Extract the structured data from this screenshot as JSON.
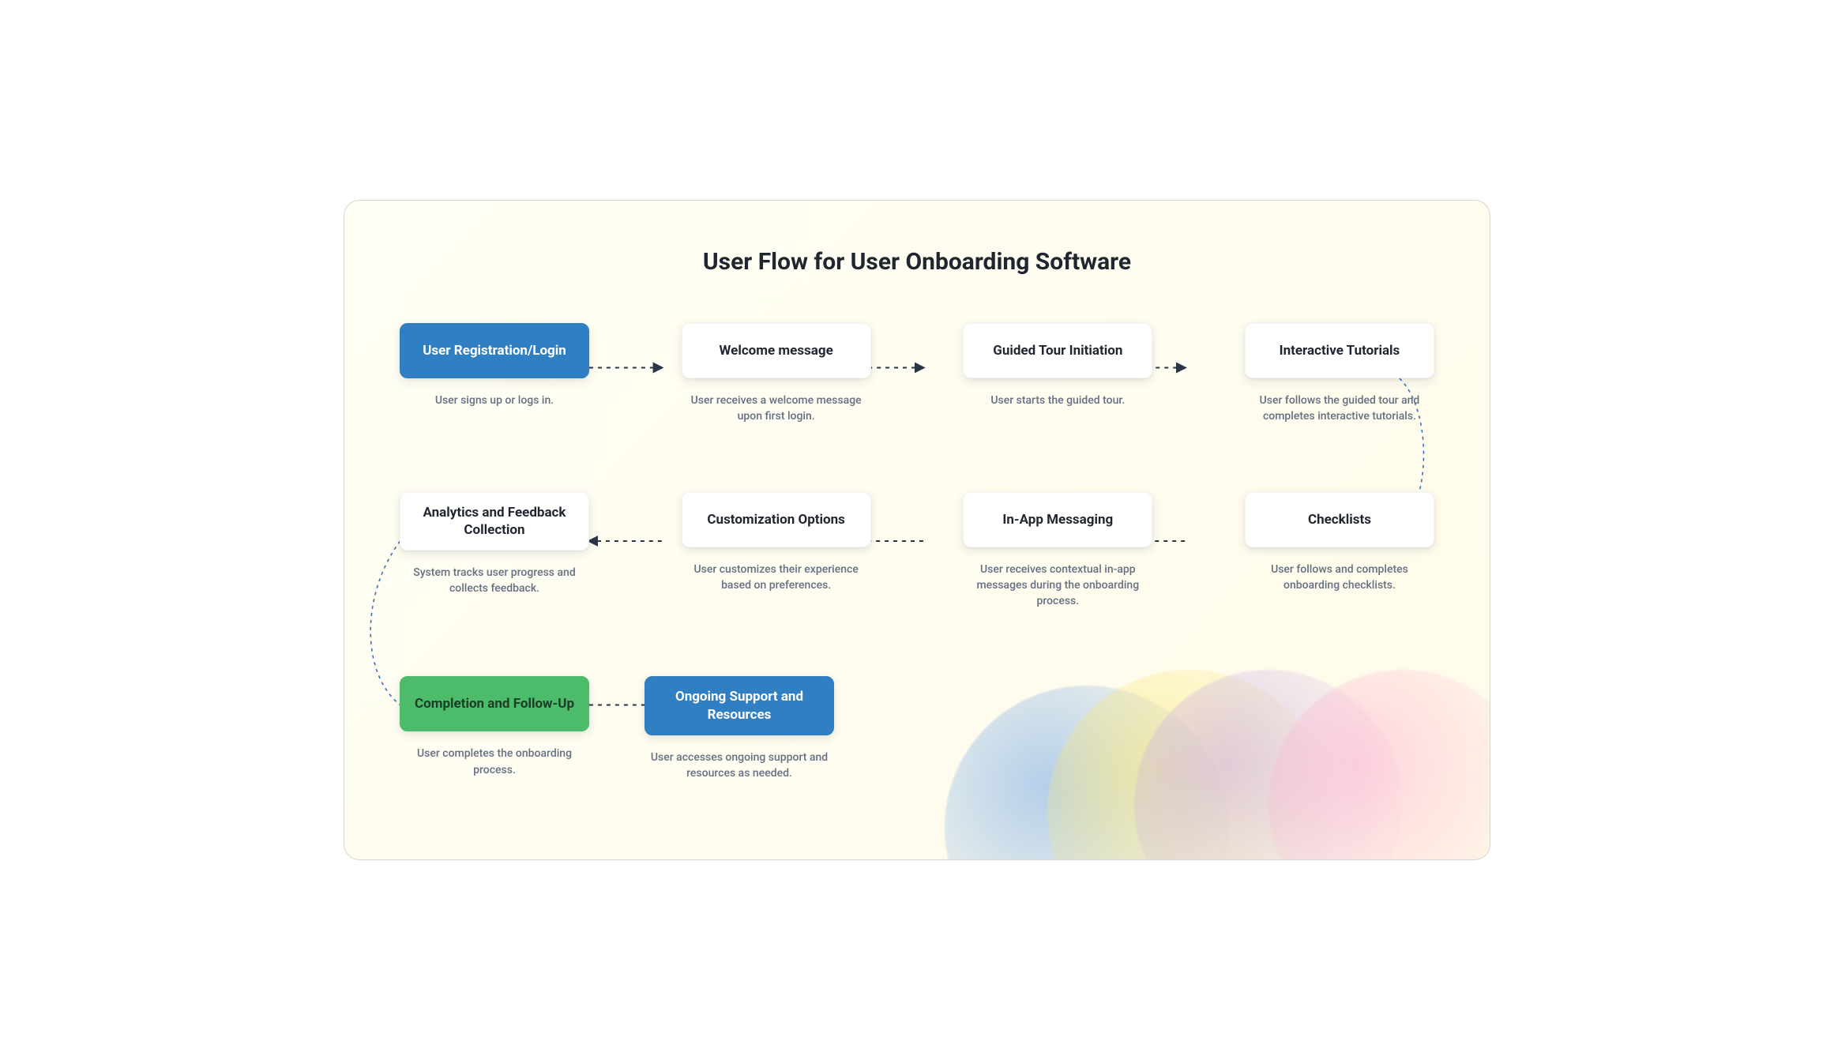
{
  "title": "User Flow for User Onboarding Software",
  "steps": [
    {
      "label": "User Registration/Login",
      "desc": "User signs up or logs in.",
      "style": "blue"
    },
    {
      "label": "Welcome message",
      "desc": "User receives a welcome message upon first login.",
      "style": "white"
    },
    {
      "label": "Guided Tour Initiation",
      "desc": "User starts the guided tour.",
      "style": "white"
    },
    {
      "label": "Interactive Tutorials",
      "desc": "User follows the guided tour and completes interactive tutorials.",
      "style": "white"
    },
    {
      "label": "Analytics and Feedback Collection",
      "desc": "System tracks user progress and collects feedback.",
      "style": "white"
    },
    {
      "label": "Customization Options",
      "desc": "User customizes their experience based on preferences.",
      "style": "white"
    },
    {
      "label": "In-App Messaging",
      "desc": "User receives contextual in-app messages during the onboarding process.",
      "style": "white"
    },
    {
      "label": "Checklists",
      "desc": "User follows and completes onboarding checklists.",
      "style": "white"
    },
    {
      "label": "Completion and Follow-Up",
      "desc": "User completes the onboarding process.",
      "style": "green"
    },
    {
      "label": "Ongoing Support and Resources",
      "desc": "User accesses ongoing support and resources as needed.",
      "style": "blue"
    }
  ],
  "colors": {
    "blue": "#2f7fc2",
    "green": "#4cbb6a",
    "connector_dark": "#2a3646",
    "connector_blue": "#3a6fb5"
  }
}
